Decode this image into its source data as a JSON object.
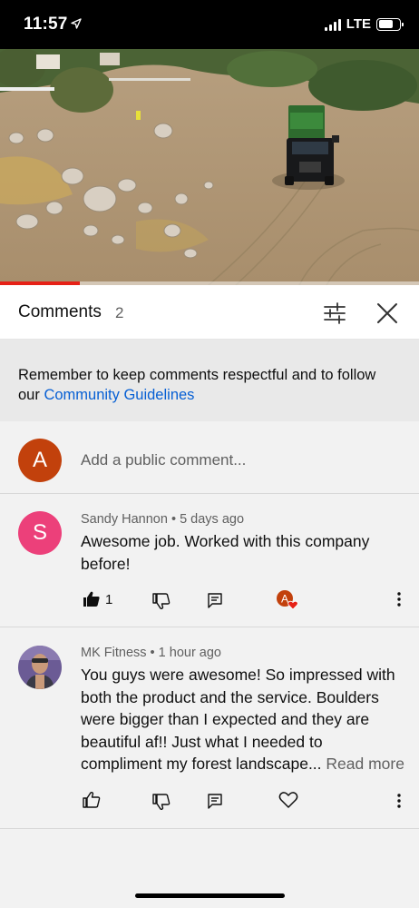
{
  "status_bar": {
    "time": "11:57",
    "network": "LTE",
    "icons": [
      "location-arrow-icon",
      "signal-icon",
      "battery-icon"
    ]
  },
  "video": {
    "description_icon": "video-thumbnail",
    "progress_fraction": 0.19
  },
  "comments_panel": {
    "title": "Comments",
    "count": "2",
    "filter_icon": "sliders-icon",
    "close_icon": "close-icon"
  },
  "notice": {
    "text": "Remember to keep comments respectful and to follow our ",
    "link": "Community Guidelines"
  },
  "add_comment": {
    "avatar_letter": "A",
    "avatar_color": "#c2410c",
    "placeholder": "Add a public comment..."
  },
  "comments": [
    {
      "author": "Sandy Hannon",
      "separator": " • ",
      "time": "5 days ago",
      "avatar_letter": "S",
      "avatar_color": "#ec407a",
      "text": "Awesome job.  Worked with this company before!",
      "likes": "1",
      "liked": true,
      "creator_hearted": true
    },
    {
      "author": "MK Fitness",
      "separator": " • ",
      "time": "1 hour ago",
      "avatar_letter": "",
      "avatar_color": "#6b5b95",
      "text": "You guys were awesome! So impressed with both the product and the service. Boulders were bigger than I expected and they are beautiful af!! Just what I needed to compliment my forest landscape...",
      "read_more": "Read more",
      "likes": "",
      "liked": false,
      "creator_hearted": false
    }
  ],
  "colors": {
    "link": "#065fd4",
    "progress": "#e62117",
    "heart": "#e62117"
  }
}
